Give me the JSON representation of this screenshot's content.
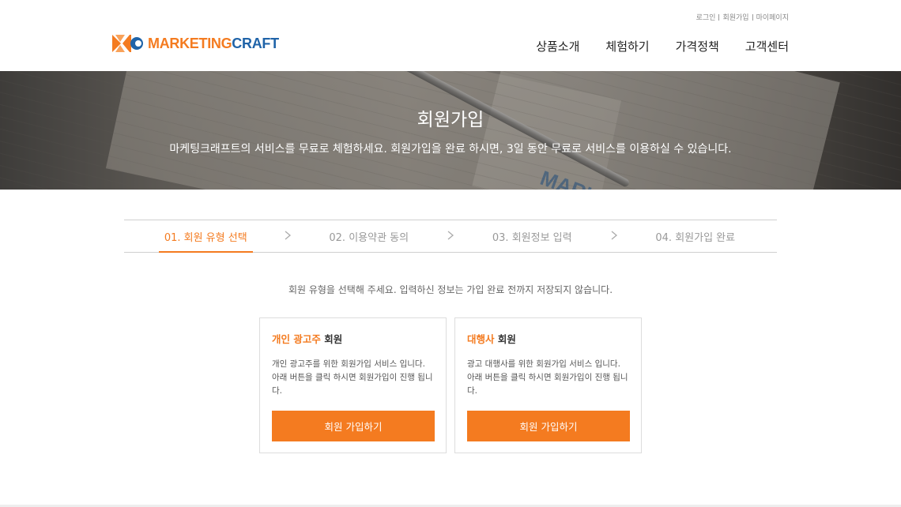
{
  "header": {
    "util_links": [
      "로그인",
      "회원가입",
      "마이페이지"
    ],
    "logo": {
      "part1": "MARKETING",
      "part2": "CRAFT"
    },
    "nav": [
      "상품소개",
      "체험하기",
      "가격정책",
      "고객센터"
    ]
  },
  "hero": {
    "title": "회원가입",
    "description": "마케팅크래프트의 서비스를 무료로 체험하세요. 회원가입을 완료 하시면, 3일 동안 무료로 서비스를 이용하실 수 있습니다.",
    "watermark": "MARKETINGCRAFT"
  },
  "steps": [
    {
      "label": "01. 회원 유형 선택",
      "active": true
    },
    {
      "label": "02. 이용약관 동의",
      "active": false
    },
    {
      "label": "03. 회원정보 입력",
      "active": false
    },
    {
      "label": "04. 회원가입 완료",
      "active": false
    }
  ],
  "guide_text": "회원 유형을 선택해 주세요. 입력하신 정보는 가입 완료 전까지 저장되지 않습니다.",
  "cards": [
    {
      "title_highlight": "개인 광고주",
      "title_rest": " 회원",
      "description": "개인 광고주를 위한 회원가입 서비스 입니다. 아래 버튼을 클릭 하시면 회원가입이 진행 됩니다.",
      "button": "회원 가입하기"
    },
    {
      "title_highlight": "대행사",
      "title_rest": " 회원",
      "description": "광고 대행사를 위한 회원가입 서비스 입니다. 아래 버튼을 클릭 하시면 회원가입이 진행 됩니다.",
      "button": "회원 가입하기"
    }
  ],
  "colors": {
    "accent": "#f47b20",
    "brand_blue": "#1f63a8"
  }
}
